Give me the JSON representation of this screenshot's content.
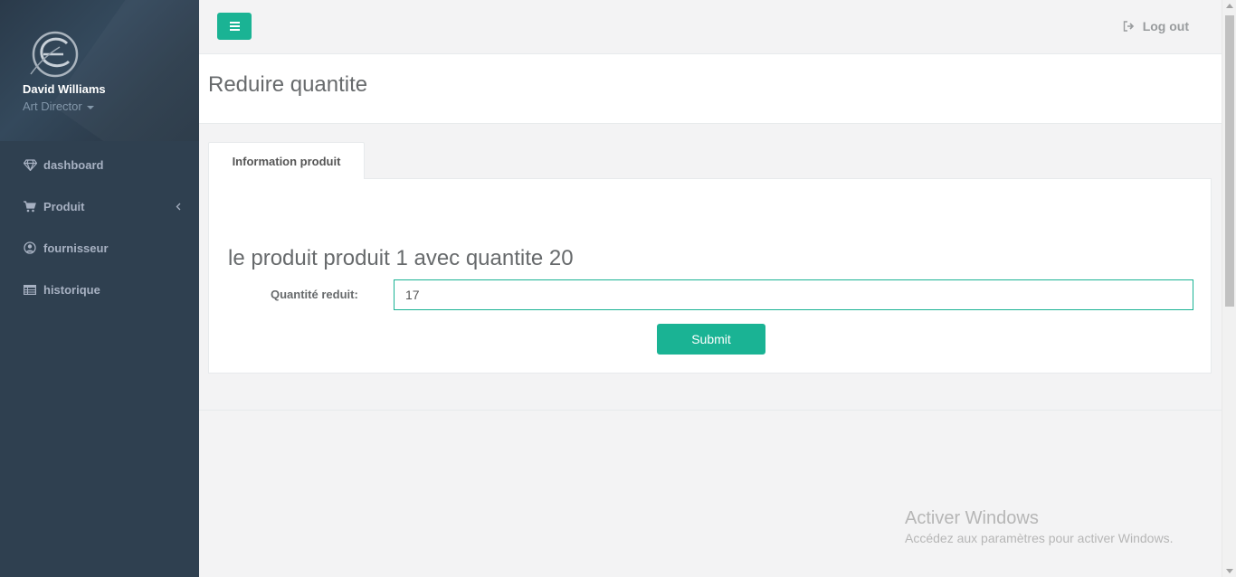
{
  "user": {
    "name": "David Williams",
    "role": "Art Director"
  },
  "sidebar": {
    "items": [
      {
        "label": "dashboard",
        "icon": "diamond-icon"
      },
      {
        "label": "Produit",
        "icon": "shopping-cart-icon"
      },
      {
        "label": "fournisseur",
        "icon": "user-circle-icon"
      },
      {
        "label": "historique",
        "icon": "table-icon"
      }
    ]
  },
  "header": {
    "logout_label": "Log out"
  },
  "page": {
    "title": "Reduire quantite"
  },
  "tabs": [
    {
      "label": "Information produit"
    }
  ],
  "form": {
    "heading": "le produit produit 1 avec quantite 20",
    "label": "Quantité reduit:",
    "value": "17",
    "submit_label": "Submit"
  },
  "watermark": {
    "title": "Activer Windows",
    "subtitle": "Accédez aux paramètres pour activer Windows."
  },
  "colors": {
    "accent": "#1ab394",
    "sidebar": "#2f4050",
    "sidebar_text": "#a7b1c2"
  }
}
